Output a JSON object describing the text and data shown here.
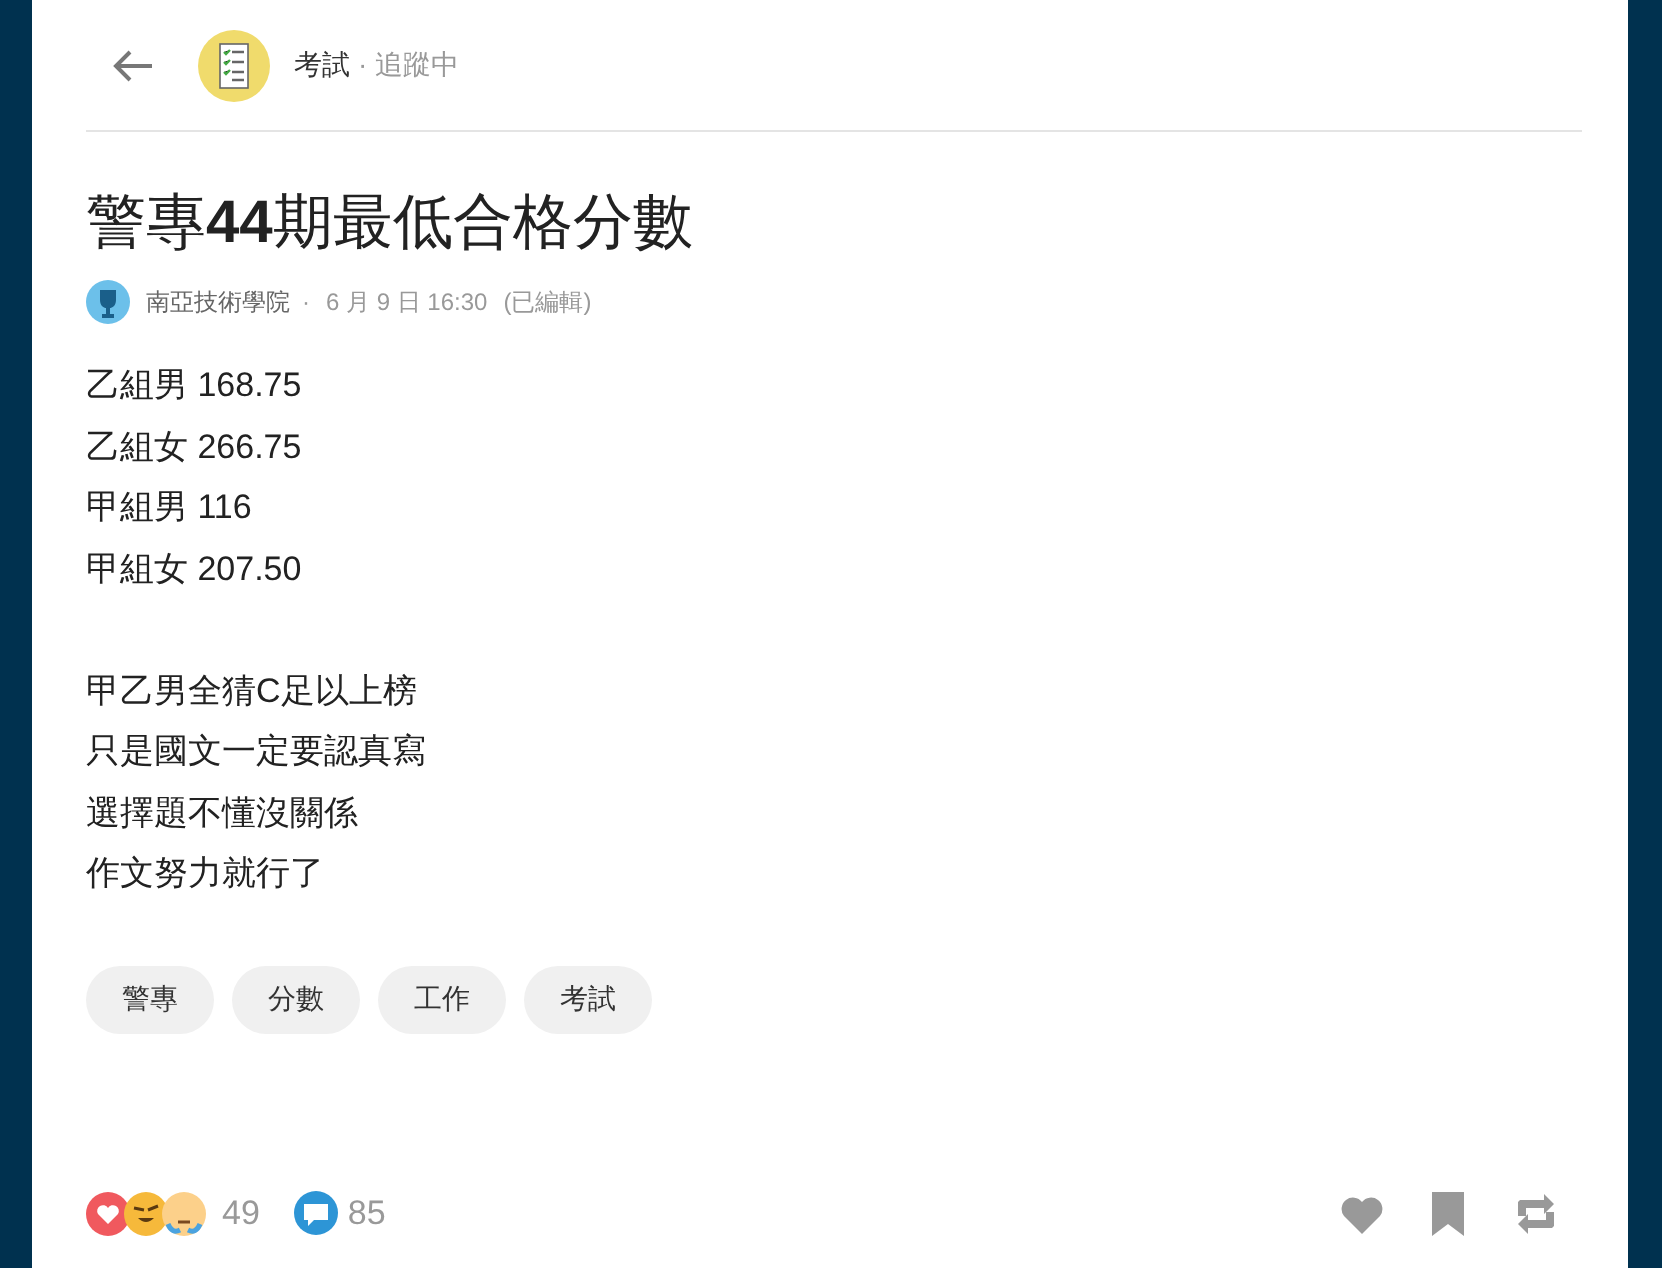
{
  "header": {
    "forum": "考試",
    "separator": "·",
    "follow_status": "追蹤中"
  },
  "post": {
    "title": "警專**44**期最低合格分數",
    "author": "南亞技術學院",
    "separator": "·",
    "date": "6 月 9 日 16:30",
    "edited": "(已編輯)",
    "paragraphs": [
      {
        "lines": [
          "乙組男 168.75",
          "乙組女 266.75",
          "甲組男 116",
          "甲組女 207.50"
        ]
      },
      {
        "lines": [
          "甲乙男全猜C足以上榜",
          "只是國文一定要認真寫",
          "選擇題不懂沒關係",
          "作文努力就行了"
        ]
      }
    ],
    "tags": [
      "警專",
      "分數",
      "工作",
      "考試"
    ]
  },
  "footer": {
    "reaction_count": "49",
    "comment_count": "85"
  }
}
